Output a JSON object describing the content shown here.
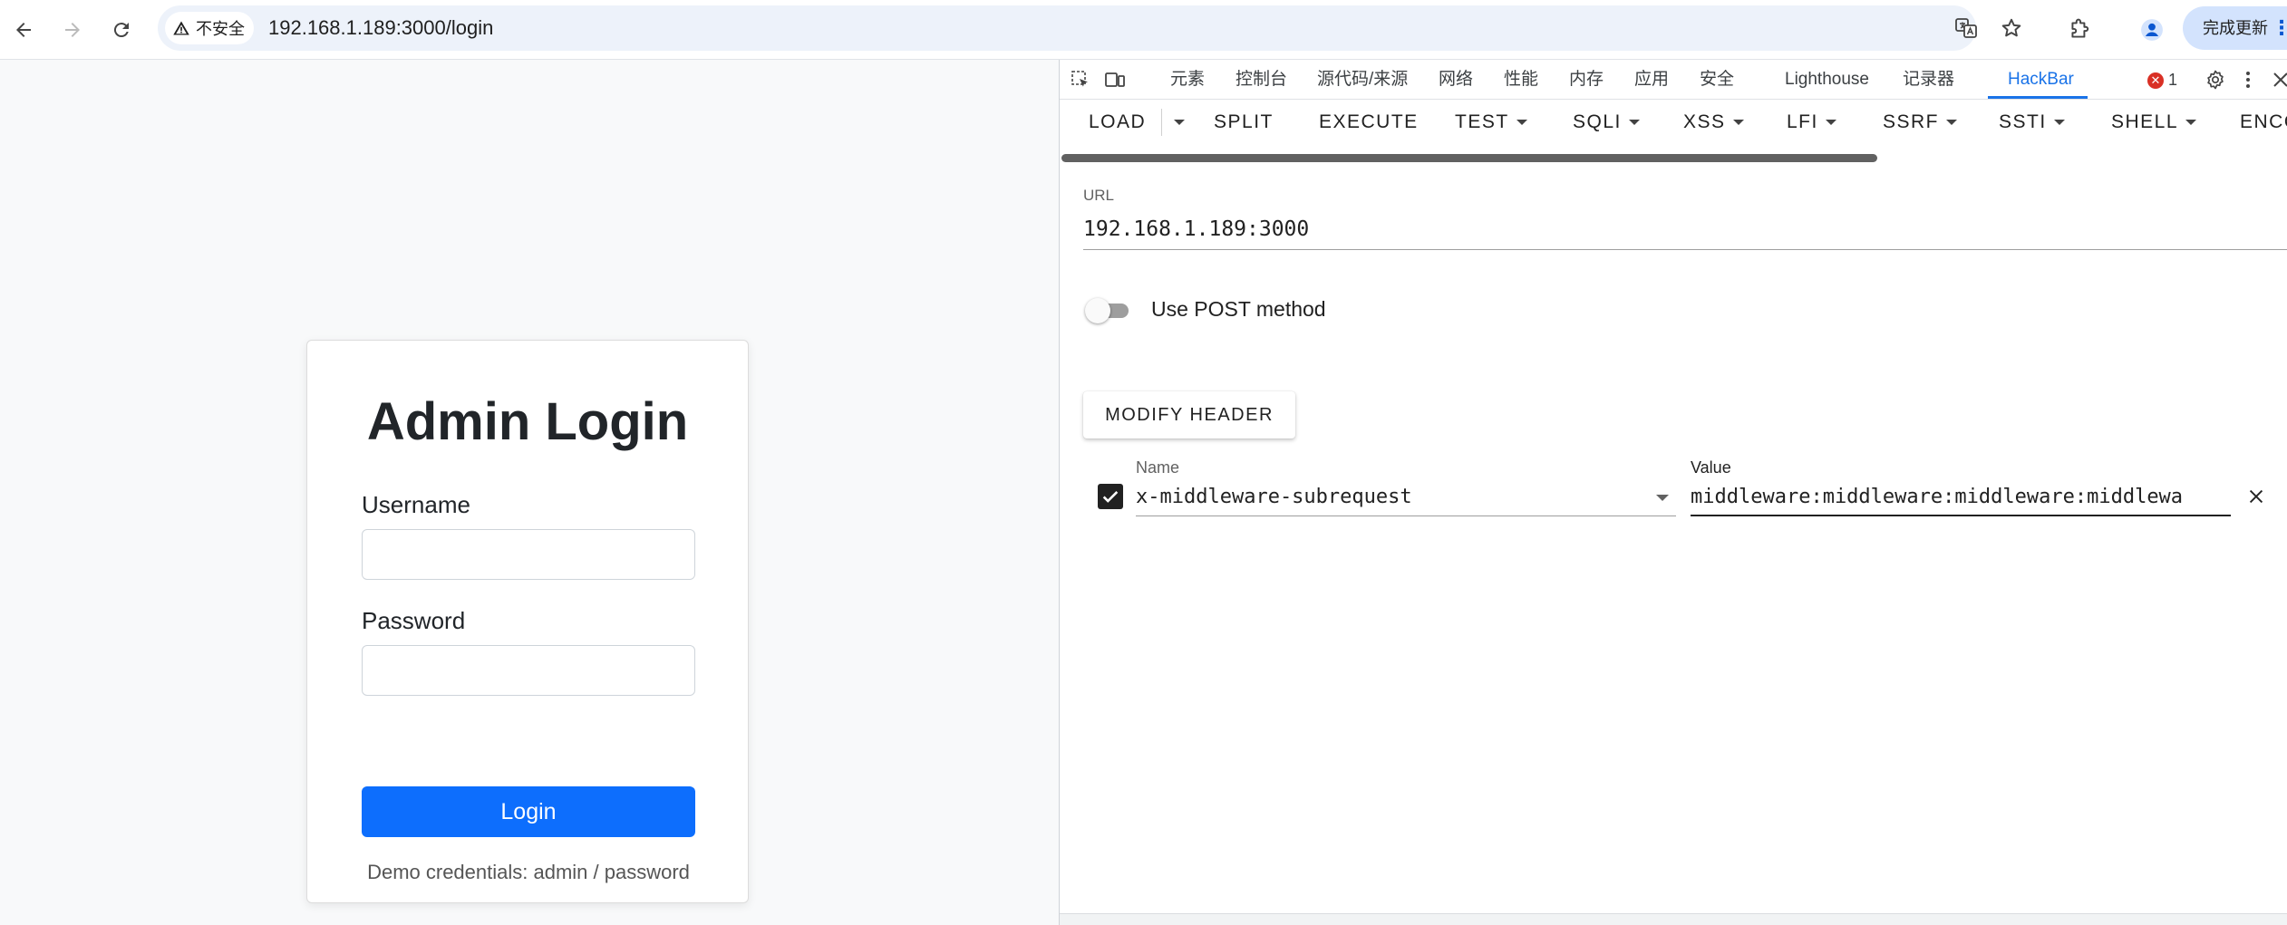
{
  "browser": {
    "security_label": "不安全",
    "url": "192.168.1.189:3000/login",
    "update_label": "完成更新",
    "menu_dots": "⋮"
  },
  "login": {
    "title": "Admin Login",
    "username_label": "Username",
    "password_label": "Password",
    "button_label": "Login",
    "demo_text": "Demo credentials: admin / password"
  },
  "devtools": {
    "tabs": [
      {
        "label": "元素"
      },
      {
        "label": "控制台"
      },
      {
        "label": "源代码/来源"
      },
      {
        "label": "网络"
      },
      {
        "label": "性能"
      },
      {
        "label": "内存"
      },
      {
        "label": "应用"
      },
      {
        "label": "安全"
      },
      {
        "label": "Lighthouse"
      },
      {
        "label": "记录器"
      },
      {
        "label": "HackBar"
      }
    ],
    "active_tab": "HackBar",
    "error_count": "1",
    "error_symbol": "✕"
  },
  "hackbar": {
    "menu": [
      {
        "label": "LOAD"
      },
      {
        "label": "SPLIT"
      },
      {
        "label": "EXECUTE"
      },
      {
        "label": "TEST"
      },
      {
        "label": "SQLI"
      },
      {
        "label": "XSS"
      },
      {
        "label": "LFI"
      },
      {
        "label": "SSRF"
      },
      {
        "label": "SSTI"
      },
      {
        "label": "SHELL"
      },
      {
        "label": "ENCO"
      }
    ],
    "url_label": "URL",
    "url_value": "192.168.1.189:3000",
    "post_label": "Use POST method",
    "post_enabled": false,
    "modify_header_label": "MODIFY HEADER",
    "header": {
      "enabled": true,
      "name_label": "Name",
      "name_value": "x-middleware-subrequest",
      "value_label": "Value",
      "value_value": "middleware:middleware:middleware:middlewa"
    }
  },
  "colors": {
    "primary_button": "#0d6efd",
    "devtools_accent": "#1a73e8",
    "omnibox_bg": "#edf2fa",
    "error_red": "#d93025"
  }
}
